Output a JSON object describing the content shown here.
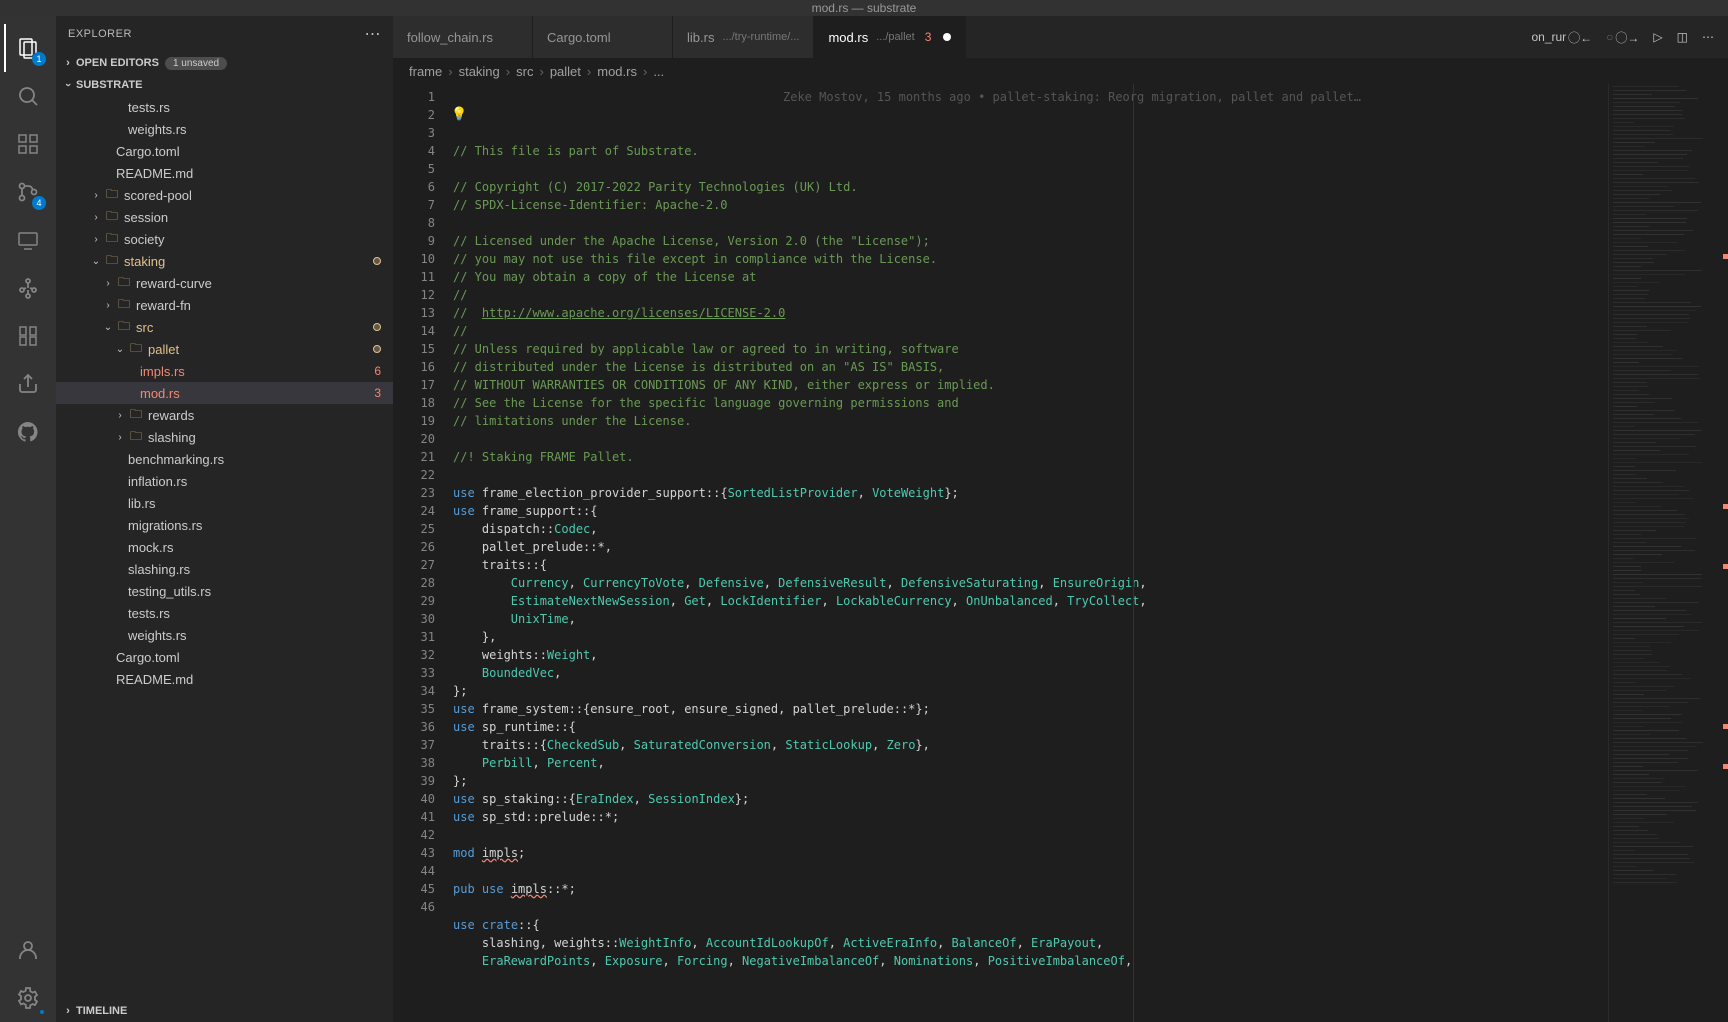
{
  "window_title": "mod.rs — substrate",
  "sidebar": {
    "title": "EXPLORER",
    "sections": {
      "open_editors": {
        "label": "OPEN EDITORS",
        "badge": "1 unsaved"
      },
      "workspace": {
        "label": "SUBSTRATE"
      },
      "timeline": {
        "label": "TIMELINE"
      }
    },
    "tree": [
      {
        "label": "tests.rs",
        "indent": 4,
        "type": "file"
      },
      {
        "label": "weights.rs",
        "indent": 4,
        "type": "file"
      },
      {
        "label": "Cargo.toml",
        "indent": 3,
        "type": "file"
      },
      {
        "label": "README.md",
        "indent": 3,
        "type": "file"
      },
      {
        "label": "scored-pool",
        "indent": 2,
        "type": "folder-closed"
      },
      {
        "label": "session",
        "indent": 2,
        "type": "folder-closed"
      },
      {
        "label": "society",
        "indent": 2,
        "type": "folder-closed"
      },
      {
        "label": "staking",
        "indent": 2,
        "type": "folder-open",
        "modified": true,
        "mod_dot": true
      },
      {
        "label": "reward-curve",
        "indent": 3,
        "type": "folder-closed"
      },
      {
        "label": "reward-fn",
        "indent": 3,
        "type": "folder-closed"
      },
      {
        "label": "src",
        "indent": 3,
        "type": "folder-open",
        "modified": true,
        "mod_dot": true
      },
      {
        "label": "pallet",
        "indent": 4,
        "type": "folder-open",
        "modified": true,
        "mod_dot": true
      },
      {
        "label": "impls.rs",
        "indent": 5,
        "type": "file",
        "error": true,
        "err_count": "6"
      },
      {
        "label": "mod.rs",
        "indent": 5,
        "type": "file",
        "error": true,
        "err_count": "3",
        "active": true
      },
      {
        "label": "rewards",
        "indent": 4,
        "type": "folder-closed"
      },
      {
        "label": "slashing",
        "indent": 4,
        "type": "folder-closed"
      },
      {
        "label": "benchmarking.rs",
        "indent": 4,
        "type": "file"
      },
      {
        "label": "inflation.rs",
        "indent": 4,
        "type": "file"
      },
      {
        "label": "lib.rs",
        "indent": 4,
        "type": "file"
      },
      {
        "label": "migrations.rs",
        "indent": 4,
        "type": "file"
      },
      {
        "label": "mock.rs",
        "indent": 4,
        "type": "file"
      },
      {
        "label": "slashing.rs",
        "indent": 4,
        "type": "file"
      },
      {
        "label": "testing_utils.rs",
        "indent": 4,
        "type": "file"
      },
      {
        "label": "tests.rs",
        "indent": 4,
        "type": "file"
      },
      {
        "label": "weights.rs",
        "indent": 4,
        "type": "file"
      },
      {
        "label": "Cargo.toml",
        "indent": 3,
        "type": "file"
      },
      {
        "label": "README.md",
        "indent": 3,
        "type": "file"
      }
    ]
  },
  "activity_badges": {
    "explorer": "1",
    "scm": "4"
  },
  "tabs": [
    {
      "label": "follow_chain.rs",
      "path": ""
    },
    {
      "label": "Cargo.toml",
      "path": ""
    },
    {
      "label": "lib.rs",
      "path": ".../try-runtime/..."
    },
    {
      "label": "mod.rs",
      "path": ".../pallet",
      "err": "3",
      "active": true,
      "modified": true
    }
  ],
  "tab_right": {
    "func": "on_rur"
  },
  "breadcrumb": [
    "frame",
    "staking",
    "src",
    "pallet",
    "mod.rs",
    "..."
  ],
  "blame": "Zeke Mostov, 15 months ago • pallet-staking: Reorg migration, pallet and pallet…",
  "code_lines": [
    {
      "n": 1,
      "html": "<span class='c-comment'>// This file is part of Substrate.</span>"
    },
    {
      "n": 2,
      "html": ""
    },
    {
      "n": 3,
      "html": "<span class='c-comment'>// Copyright (C) 2017-2022 Parity Technologies (UK) Ltd.</span>"
    },
    {
      "n": 4,
      "html": "<span class='c-comment'>// SPDX-License-Identifier: Apache-2.0</span>"
    },
    {
      "n": 5,
      "html": ""
    },
    {
      "n": 6,
      "html": "<span class='c-comment'>// Licensed under the Apache License, Version 2.0 (the \"License\");</span>"
    },
    {
      "n": 7,
      "html": "<span class='c-comment'>// you may not use this file except in compliance with the License.</span>"
    },
    {
      "n": 8,
      "html": "<span class='c-comment'>// You may obtain a copy of the License at</span>"
    },
    {
      "n": 9,
      "html": "<span class='c-comment'>//</span>"
    },
    {
      "n": 10,
      "html": "<span class='c-comment'>// &nbsp;<span class='c-link'>http://www.apache.org/licenses/LICENSE-2.0</span></span>"
    },
    {
      "n": 11,
      "html": "<span class='c-comment'>//</span>"
    },
    {
      "n": 12,
      "html": "<span class='c-comment'>// Unless required by applicable law or agreed to in writing, software</span>"
    },
    {
      "n": 13,
      "html": "<span class='c-comment'>// distributed under the License is distributed on an \"AS IS\" BASIS,</span>"
    },
    {
      "n": 14,
      "html": "<span class='c-comment'>// WITHOUT WARRANTIES OR CONDITIONS OF ANY KIND, either express or implied.</span>"
    },
    {
      "n": 15,
      "html": "<span class='c-comment'>// See the License for the specific language governing permissions and</span>"
    },
    {
      "n": 16,
      "html": "<span class='c-comment'>// limitations under the License.</span>"
    },
    {
      "n": 17,
      "html": ""
    },
    {
      "n": 18,
      "html": "<span class='c-comment'>//! Staking FRAME Pallet.</span>"
    },
    {
      "n": 19,
      "html": ""
    },
    {
      "n": 20,
      "html": "<span class='c-keyword'>use</span> frame_election_provider_support::{<span class='c-type'>SortedListProvider</span>, <span class='c-type'>VoteWeight</span>};"
    },
    {
      "n": 21,
      "html": "<span class='c-keyword'>use</span> frame_support::{"
    },
    {
      "n": 22,
      "html": "    dispatch::<span class='c-type'>Codec</span>,"
    },
    {
      "n": 23,
      "html": "    pallet_prelude::*,"
    },
    {
      "n": 24,
      "html": "    traits::{"
    },
    {
      "n": 25,
      "html": "        <span class='c-type'>Currency</span>, <span class='c-type'>CurrencyToVote</span>, <span class='c-type'>Defensive</span>, <span class='c-type'>DefensiveResult</span>, <span class='c-type'>DefensiveSaturating</span>, <span class='c-type'>EnsureOrigin</span>,"
    },
    {
      "n": 26,
      "html": "        <span class='c-type'>EstimateNextNewSession</span>, <span class='c-type'>Get</span>, <span class='c-type'>LockIdentifier</span>, <span class='c-type'>LockableCurrency</span>, <span class='c-type'>OnUnbalanced</span>, <span class='c-type'>TryCollect</span>,"
    },
    {
      "n": 27,
      "html": "        <span class='c-type'>UnixTime</span>,"
    },
    {
      "n": 28,
      "html": "    },"
    },
    {
      "n": 29,
      "html": "    weights::<span class='c-type'>Weight</span>,"
    },
    {
      "n": 30,
      "html": "    <span class='c-type'>BoundedVec</span>,"
    },
    {
      "n": 31,
      "html": "};"
    },
    {
      "n": 32,
      "html": "<span class='c-keyword'>use</span> frame_system::{ensure_root, ensure_signed, pallet_prelude::*};"
    },
    {
      "n": 33,
      "html": "<span class='c-keyword'>use</span> sp_runtime::{"
    },
    {
      "n": 34,
      "html": "    traits::{<span class='c-type'>CheckedSub</span>, <span class='c-type'>SaturatedConversion</span>, <span class='c-type'>StaticLookup</span>, <span class='c-type'>Zero</span>},"
    },
    {
      "n": 35,
      "html": "    <span class='c-type'>Perbill</span>, <span class='c-type'>Percent</span>,"
    },
    {
      "n": 36,
      "html": "};"
    },
    {
      "n": 37,
      "html": "<span class='c-keyword'>use</span> sp_staking::{<span class='c-type'>EraIndex</span>, <span class='c-type'>SessionIndex</span>};"
    },
    {
      "n": 38,
      "html": "<span class='c-keyword'>use</span> sp_std::prelude::*;"
    },
    {
      "n": 39,
      "html": ""
    },
    {
      "n": 40,
      "html": "<span class='c-keyword'>mod</span> <span style='text-decoration:underline wavy #f48771'>impls</span>;"
    },
    {
      "n": 41,
      "html": ""
    },
    {
      "n": 42,
      "html": "<span class='c-keyword'>pub use</span> <span style='text-decoration:underline wavy #f48771'>impls</span>::*;"
    },
    {
      "n": 43,
      "html": ""
    },
    {
      "n": 44,
      "html": "<span class='c-keyword'>use</span> <span class='c-keyword'>crate</span>::{"
    },
    {
      "n": 45,
      "html": "    slashing, weights::<span class='c-type'>WeightInfo</span>, <span class='c-type'>AccountIdLookupOf</span>, <span class='c-type'>ActiveEraInfo</span>, <span class='c-type'>BalanceOf</span>, <span class='c-type'>EraPayout</span>,"
    },
    {
      "n": 46,
      "html": "    <span class='c-type'>EraRewardPoints</span>, <span class='c-type'>Exposure</span>, <span class='c-type'>Forcing</span>, <span class='c-type'>NegativeImbalanceOf</span>, <span class='c-type'>Nominations</span>, <span class='c-type'>PositiveImbalanceOf</span>,"
    }
  ]
}
